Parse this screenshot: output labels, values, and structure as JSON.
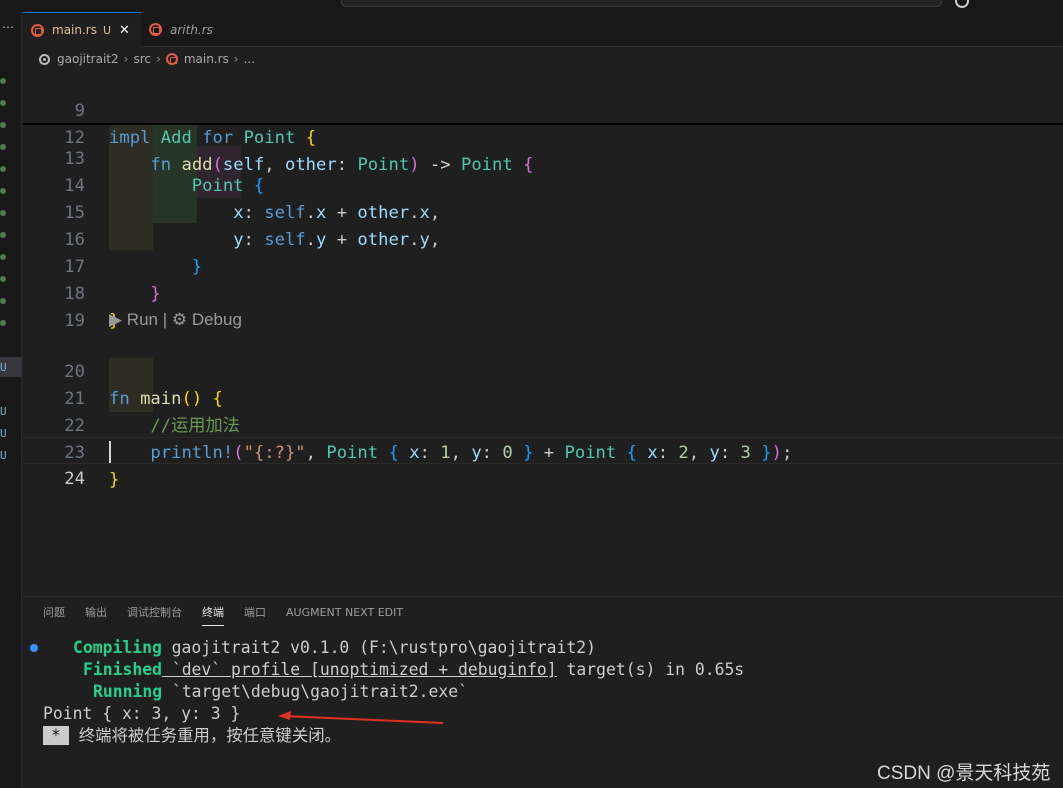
{
  "tabs": [
    {
      "name": "main.rs",
      "modified": "U",
      "close": "✕"
    },
    {
      "name": "arith.rs"
    }
  ],
  "breadcrumb": [
    "gaojitrait2",
    "src",
    "main.rs",
    "..."
  ],
  "editor": {
    "sticky": [
      {
        "ln": "9"
      },
      {
        "ln": "12"
      }
    ],
    "lines": [
      {
        "ln": "13"
      },
      {
        "ln": "14"
      },
      {
        "ln": "15"
      },
      {
        "ln": "16"
      },
      {
        "ln": "17"
      },
      {
        "ln": "18"
      },
      {
        "ln": "19"
      },
      {
        "ln": "20"
      },
      {
        "ln": "21"
      },
      {
        "ln": "22"
      },
      {
        "ln": "23"
      },
      {
        "ln": "24"
      }
    ],
    "codelens": {
      "run": "▶ Run",
      "sep": " | ",
      "debug": "⚙ Debug"
    }
  },
  "panel": {
    "tabs": [
      "问题",
      "输出",
      "调试控制台",
      "终端",
      "端口",
      "AUGMENT NEXT EDIT"
    ],
    "active_tab": "终端",
    "terminal": {
      "l1_status": "Compiling",
      "l1_text": " gaojitrait2 v0.1.0 (F:\\rustpro\\gaojitrait2)",
      "l2_status": "Finished",
      "l2_text_a": " `dev` profile [unoptimized + debuginfo]",
      "l2_text_b": " target(s) in 0.65s",
      "l3_status": "Running",
      "l3_text": " `target\\debug\\gaojitrait2.exe`",
      "output": "Point { x: 3, y: 3 }",
      "prompt_star": "*",
      "prompt_text": " 终端将被任务重用，按任意键关闭。"
    }
  },
  "watermark": "CSDN @景天科技苑",
  "colors": {
    "accent": "#0078d4",
    "terminal_green": "#23d18b",
    "arrow": "#e0301e"
  }
}
